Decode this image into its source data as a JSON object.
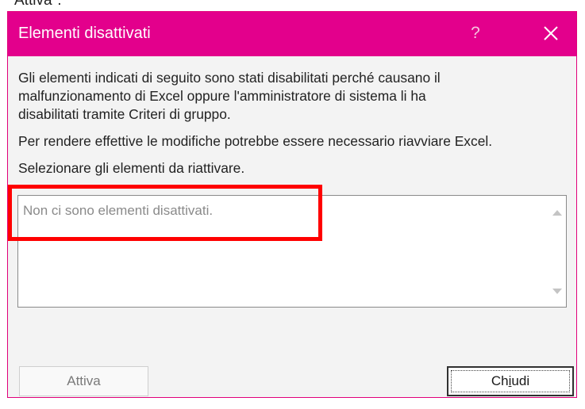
{
  "top_fragment": "Attiva\".",
  "dialog": {
    "title": "Elementi disattivati",
    "help_label": "?",
    "close_icon": "close-icon",
    "paragraphs": [
      "Gli elementi indicati di seguito sono stati disabilitati perché causano il",
      "malfunzionamento di Excel oppure l'amministratore di sistema li ha",
      "disabilitati tramite Criteri di gruppo."
    ],
    "restart_note": "Per rendere effettive le modifiche potrebbe essere necessario riavviare Excel.",
    "select_prompt": "Selezionare gli elementi da riattivare.",
    "list": {
      "empty_message": "Non ci sono elementi disattivati.",
      "items": []
    },
    "buttons": {
      "activate": "Attiva",
      "close_before": "Ch",
      "close_accel": "i",
      "close_after": "udi"
    }
  },
  "colors": {
    "titlebar": "#e3008c",
    "highlight": "#ff0000"
  }
}
